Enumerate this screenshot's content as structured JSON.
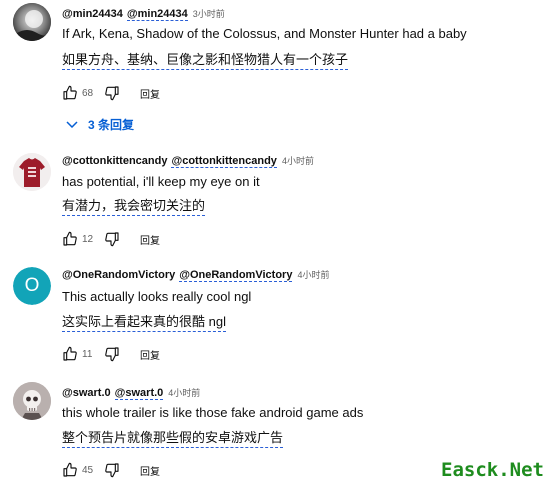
{
  "comments": [
    {
      "handle": "@min24434",
      "mention": "@min24434",
      "time": "3小时前",
      "text": "If Ark, Kena, Shadow of the Colossus, and Monster Hunter had a baby",
      "translation": "如果方舟、基纳、巨像之影和怪物猎人有一个孩子",
      "likes": "68",
      "reply_label": "回复",
      "avatar_icon": "moon-icon",
      "replies_label": "3 条回复"
    },
    {
      "handle": "@cottonkittencandy",
      "mention": "@cottonkittencandy",
      "time": "4小时前",
      "text": "has potential, i'll keep my eye on it",
      "translation": "有潜力，我会密切关注的",
      "likes": "12",
      "reply_label": "回复",
      "avatar_icon": "shirt-icon"
    },
    {
      "handle": "@OneRandomVictory",
      "mention": "@OneRandomVictory",
      "time": "4小时前",
      "text": "This actually looks really cool ngl",
      "translation": "这实际上看起来真的很酷 ngl",
      "likes": "11",
      "reply_label": "回复",
      "avatar_letter": "O",
      "avatar_color": "#12a4b8"
    },
    {
      "handle": "@swart.0",
      "mention": "@swart.0",
      "time": "4小时前",
      "text": "this whole trailer is like those fake android game ads",
      "translation": "整个预告片就像那些假的安卓游戏广告",
      "likes": "45",
      "reply_label": "回复",
      "avatar_icon": "skull-icon"
    }
  ],
  "watermark": "Easck.Net"
}
